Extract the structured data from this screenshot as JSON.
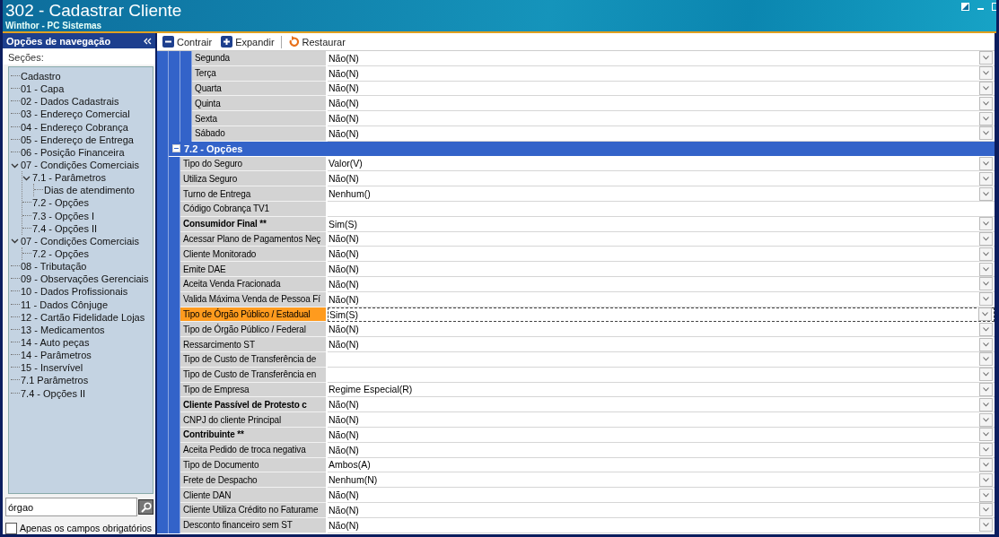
{
  "window": {
    "title": "302 - Cadastrar Cliente",
    "subtitle": "Winthor - PC Sistemas"
  },
  "navigation": {
    "header": "Opções de navegação",
    "sections_label": "Seções:",
    "tree": [
      {
        "label": "Cadastro"
      },
      {
        "label": "01 - Capa"
      },
      {
        "label": "02 - Dados Cadastrais"
      },
      {
        "label": "03 - Endereço Comercial"
      },
      {
        "label": "04 - Endereço Cobrança"
      },
      {
        "label": "05 - Endereço de Entrega"
      },
      {
        "label": "06 - Posição Financeira"
      },
      {
        "label": "07 - Condições Comerciais",
        "expanded": true,
        "children": [
          {
            "label": "7.1 - Parâmetros",
            "expanded": true,
            "children": [
              {
                "label": "Dias de atendimento"
              }
            ]
          },
          {
            "label": "7.2 - Opções"
          },
          {
            "label": "7.3 - Opções I"
          },
          {
            "label": "7.4 - Opções II"
          }
        ]
      },
      {
        "label": "07 - Condições Comerciais",
        "expanded": true,
        "children": [
          {
            "label": "7.2 - Opções"
          }
        ]
      },
      {
        "label": "08 - Tributação"
      },
      {
        "label": "09 - Observações Gerenciais"
      },
      {
        "label": "10 - Dados Profissionais"
      },
      {
        "label": "11 - Dados Cônjuge"
      },
      {
        "label": "12 - Cartão Fidelidade Lojas"
      },
      {
        "label": "13 - Medicamentos"
      },
      {
        "label": "14 - Auto peças"
      },
      {
        "label": "14 - Parâmetros"
      },
      {
        "label": "15 - Inservível"
      },
      {
        "label": "7.1 Parâmetros"
      },
      {
        "label": "7.4 - Opções II"
      }
    ],
    "search": {
      "value": "órgao"
    },
    "required_only": {
      "label": "Apenas os campos obrigatórios",
      "checked": false
    }
  },
  "toolbar": [
    {
      "kind": "collapse",
      "label": "Contrair"
    },
    {
      "kind": "expand",
      "label": "Expandir"
    },
    {
      "kind": "restore",
      "label": "Restaurar"
    }
  ],
  "grid": {
    "items": [
      {
        "kind": "group",
        "children": [
          {
            "kind": "group",
            "children": [
              {
                "kind": "row",
                "label": "Segunda",
                "value": "Não(N)",
                "dropdown": true,
                "bold": false,
                "selected": false
              },
              {
                "kind": "row",
                "label": "Terça",
                "value": "Não(N)",
                "dropdown": true,
                "bold": false,
                "selected": false
              },
              {
                "kind": "row",
                "label": "Quarta",
                "value": "Não(N)",
                "dropdown": true,
                "bold": false,
                "selected": false
              },
              {
                "kind": "row",
                "label": "Quinta",
                "value": "Não(N)",
                "dropdown": true,
                "bold": false,
                "selected": false
              },
              {
                "kind": "row",
                "label": "Sexta",
                "value": "Não(N)",
                "dropdown": true,
                "bold": false,
                "selected": false
              },
              {
                "kind": "row",
                "label": "Sábado",
                "value": "Não(N)",
                "dropdown": true,
                "bold": false,
                "selected": false
              }
            ]
          }
        ]
      },
      {
        "kind": "section",
        "title": "7.2 - Opções",
        "expanded": true,
        "children": [
          {
            "kind": "row",
            "label": "Tipo do Seguro",
            "value": "Valor(V)",
            "dropdown": true,
            "bold": false,
            "selected": false
          },
          {
            "kind": "row",
            "label": "Utiliza Seguro",
            "value": "Não(N)",
            "dropdown": true,
            "bold": false,
            "selected": false
          },
          {
            "kind": "row",
            "label": "Turno de Entrega",
            "value": "Nenhum()",
            "dropdown": true,
            "bold": false,
            "selected": false
          },
          {
            "kind": "row",
            "label": "Código Cobrança TV1",
            "dropdown": false,
            "bold": false,
            "selected": false
          },
          {
            "kind": "row",
            "label": "Consumidor Final **",
            "value": "Sim(S)",
            "dropdown": true,
            "bold": true,
            "selected": false
          },
          {
            "kind": "row",
            "label": "Acessar Plano de Pagamentos Neç",
            "value": "Não(N)",
            "dropdown": true,
            "bold": false,
            "selected": false
          },
          {
            "kind": "row",
            "label": "Cliente Monitorado",
            "value": "Não(N)",
            "dropdown": true,
            "bold": false,
            "selected": false
          },
          {
            "kind": "row",
            "label": "Emite DAE",
            "value": "Não(N)",
            "dropdown": true,
            "bold": false,
            "selected": false
          },
          {
            "kind": "row",
            "label": "Aceita Venda Fracionada",
            "value": "Não(N)",
            "dropdown": true,
            "bold": false,
            "selected": false
          },
          {
            "kind": "row",
            "label": "Valida Máxima Venda de Pessoa Fí",
            "value": "Não(N)",
            "dropdown": true,
            "bold": false,
            "selected": false
          },
          {
            "kind": "row",
            "label": "Tipo de Órgão Público / Estadual",
            "value": "Sim(S)",
            "dropdown": true,
            "bold": false,
            "selected": true
          },
          {
            "kind": "row",
            "label": "Tipo de Órgão Público / Federal",
            "value": "Não(N)",
            "dropdown": true,
            "bold": false,
            "selected": false
          },
          {
            "kind": "row",
            "label": "Ressarcimento ST",
            "value": "Não(N)",
            "dropdown": true,
            "bold": false,
            "selected": false
          },
          {
            "kind": "row",
            "label": "Tipo de Custo de Transferência de",
            "dropdown": true,
            "bold": false,
            "selected": false
          },
          {
            "kind": "row",
            "label": "Tipo de Custo de Transferência en",
            "dropdown": true,
            "bold": false,
            "selected": false
          },
          {
            "kind": "row",
            "label": "Tipo de Empresa",
            "value": "Regime Especial(R)",
            "dropdown": true,
            "bold": false,
            "selected": false
          },
          {
            "kind": "row",
            "label": "Cliente Passível de Protesto c",
            "value": "Não(N)",
            "dropdown": true,
            "bold": true,
            "selected": false
          },
          {
            "kind": "row",
            "label": "CNPJ do cliente Principal",
            "value": "Não(N)",
            "dropdown": true,
            "bold": false,
            "selected": false
          },
          {
            "kind": "row",
            "label": "Contribuinte **",
            "value": "Não(N)",
            "dropdown": true,
            "bold": true,
            "selected": false
          },
          {
            "kind": "row",
            "label": "Aceita Pedido de troca negativa",
            "value": "Não(N)",
            "dropdown": true,
            "bold": false,
            "selected": false
          },
          {
            "kind": "row",
            "label": "Tipo de Documento",
            "value": "Ambos(A)",
            "dropdown": true,
            "bold": false,
            "selected": false
          },
          {
            "kind": "row",
            "label": "Frete de Despacho",
            "value": "Nenhum(N)",
            "dropdown": true,
            "bold": false,
            "selected": false
          },
          {
            "kind": "row",
            "label": "Cliente DAN",
            "value": "Não(N)",
            "dropdown": true,
            "bold": false,
            "selected": false
          },
          {
            "kind": "row",
            "label": "Cliente Utiliza Crédito no Faturame",
            "value": "Não(N)",
            "dropdown": true,
            "bold": false,
            "selected": false
          },
          {
            "kind": "row",
            "label": "Desconto financeiro sem ST",
            "value": "Não(N)",
            "dropdown": true,
            "bold": false,
            "selected": false
          }
        ]
      }
    ]
  }
}
